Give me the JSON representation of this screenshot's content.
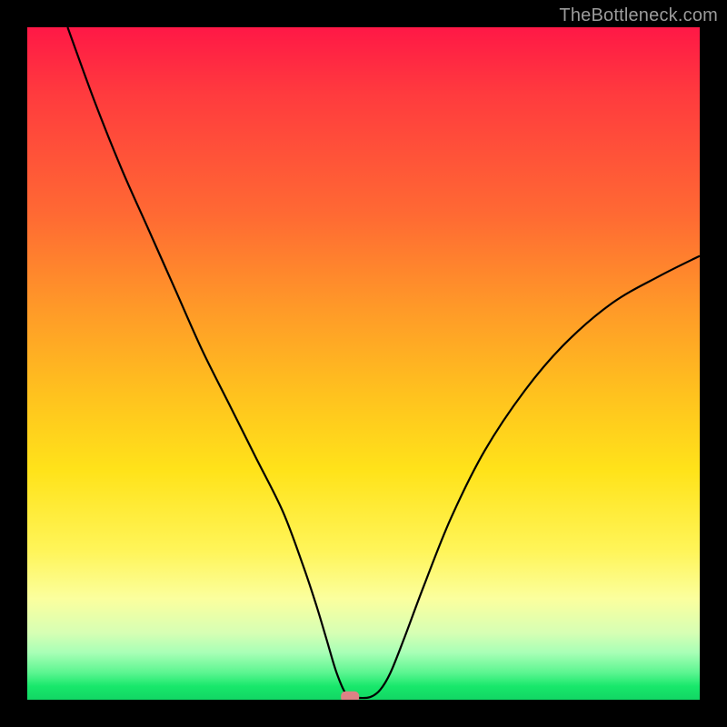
{
  "watermark": "TheBottleneck.com",
  "chart_data": {
    "type": "line",
    "title": "",
    "xlabel": "",
    "ylabel": "",
    "xlim": [
      0,
      100
    ],
    "ylim": [
      0,
      100
    ],
    "series": [
      {
        "name": "bottleneck-curve",
        "x": [
          6,
          10,
          14,
          18,
          22,
          26,
          30,
          34,
          38,
          41,
          43,
          44.5,
          46,
          47.5,
          49,
          51,
          52.5,
          54,
          56,
          59,
          63,
          68,
          74,
          80,
          87,
          94,
          100
        ],
        "y": [
          100,
          89,
          79,
          70,
          61,
          52,
          44,
          36,
          28,
          20,
          14,
          9,
          4,
          0.7,
          0.3,
          0.4,
          1.5,
          4,
          9,
          17,
          27,
          37,
          46,
          53,
          59,
          63,
          66
        ]
      }
    ],
    "marker": {
      "x": 48,
      "y": 0.3,
      "color": "#dc8285"
    },
    "gradient_stops": [
      {
        "pos": 0,
        "color": "#ff1846"
      },
      {
        "pos": 10,
        "color": "#ff3b3e"
      },
      {
        "pos": 28,
        "color": "#ff6a33"
      },
      {
        "pos": 42,
        "color": "#ff9a28"
      },
      {
        "pos": 55,
        "color": "#ffc31e"
      },
      {
        "pos": 66,
        "color": "#ffe31a"
      },
      {
        "pos": 78,
        "color": "#fff55a"
      },
      {
        "pos": 85,
        "color": "#fbff9e"
      },
      {
        "pos": 90,
        "color": "#d7ffb4"
      },
      {
        "pos": 93,
        "color": "#a8ffb6"
      },
      {
        "pos": 96,
        "color": "#5bf590"
      },
      {
        "pos": 98,
        "color": "#18e86b"
      },
      {
        "pos": 100,
        "color": "#12d664"
      }
    ]
  }
}
